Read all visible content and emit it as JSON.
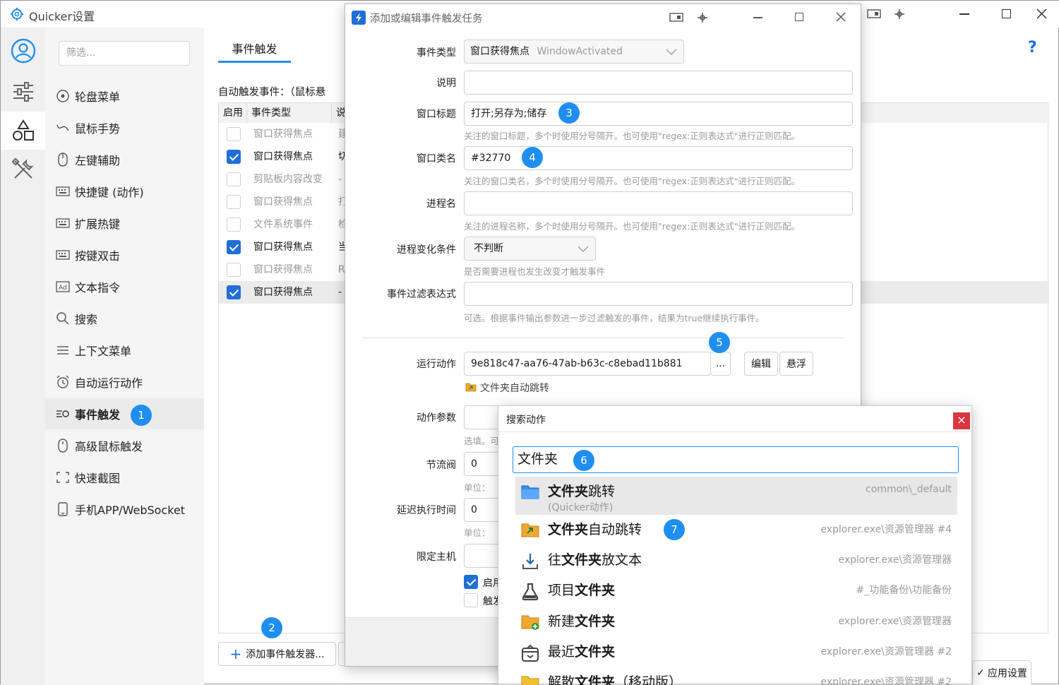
{
  "window": {
    "title": "Quicker设置",
    "help": "?"
  },
  "nav": {
    "filter_placeholder": "筛选...",
    "items": [
      {
        "label": "轮盘菜单"
      },
      {
        "label": "鼠标手势"
      },
      {
        "label": "左键辅助"
      },
      {
        "label": "快捷键 (动作)"
      },
      {
        "label": "扩展热键"
      },
      {
        "label": "按键双击"
      },
      {
        "label": "文本指令"
      },
      {
        "label": "搜索"
      },
      {
        "label": "上下文菜单"
      },
      {
        "label": "自动运行动作"
      },
      {
        "label": "事件触发"
      },
      {
        "label": "高级鼠标触发"
      },
      {
        "label": "快速截图"
      },
      {
        "label": "手机APP/WebSocket"
      }
    ]
  },
  "badges": [
    "1",
    "2",
    "3",
    "4",
    "5",
    "6",
    "7"
  ],
  "content": {
    "tab": "事件触发",
    "auto_label": "自动触发事件：（鼠标悬",
    "columns": [
      "启用",
      "事件类型",
      "说"
    ],
    "rows": [
      {
        "enabled": false,
        "type": "窗口获得焦点",
        "desc": "建",
        "dim": true
      },
      {
        "enabled": true,
        "type": "窗口获得焦点",
        "desc": "切",
        "dim": false
      },
      {
        "enabled": false,
        "type": "剪贴板内容改变",
        "desc": "-",
        "dim": true
      },
      {
        "enabled": false,
        "type": "窗口获得焦点",
        "desc": "打",
        "dim": true
      },
      {
        "enabled": false,
        "type": "文件系统事件",
        "desc": "检",
        "dim": true
      },
      {
        "enabled": true,
        "type": "窗口获得焦点",
        "desc": "当",
        "dim": false
      },
      {
        "enabled": false,
        "type": "窗口获得焦点",
        "desc": "R",
        "dim": true
      },
      {
        "enabled": true,
        "type": "窗口获得焦点",
        "desc": "-",
        "dim": false
      }
    ],
    "add_button": "添加事件触发器...",
    "apply_button": "应用设置"
  },
  "dialog": {
    "title": "添加或编辑事件触发任务",
    "event_type_label": "事件类型",
    "event_type_value": "窗口获得焦点",
    "event_type_en": "WindowActivated",
    "desc_label": "说明",
    "desc_value": "",
    "win_title_label": "窗口标题",
    "win_title_value": "打开;另存为;储存",
    "win_title_hint": "关注的窗口标题，多个时使用分号隔开。也可使用\"regex:正则表达式\"进行正则匹配。",
    "win_class_label": "窗口类名",
    "win_class_value": "#32770",
    "win_class_hint": "关注的窗口类名，多个时使用分号隔开。也可使用\"regex:正则表达式\"进行正则匹配。",
    "proc_label": "进程名",
    "proc_value": "",
    "proc_hint": "关注的进程名称，多个时使用分号隔开。也可使用\"regex:正则表达式\"进行正则匹配。",
    "proc_change_label": "进程变化条件",
    "proc_change_value": "不判断",
    "proc_change_hint": "是否需要进程也发生改变才触发事件",
    "filter_label": "事件过滤表达式",
    "filter_value": "",
    "filter_hint": "可选。根据事件输出参数进一步过滤触发的事件，结果为true继续执行事件。",
    "action_label": "运行动作",
    "action_value": "9e818c47-aa76-47ab-b63c-c8ebad11b881",
    "browse_button": "...",
    "edit_button": "编辑",
    "float_button": "悬浮",
    "action_name": "文件夹自动跳转",
    "param_label": "动作参数",
    "param_hint": "选填。可",
    "throttle_label": "节流阀",
    "throttle_value": "0",
    "throttle_hint": "单位：",
    "delay_label": "延迟执行时间",
    "delay_value": "0",
    "delay_hint": "单位：",
    "host_label": "限定主机",
    "enable_check": "启用",
    "trigger_check": "触发"
  },
  "search_popup": {
    "title": "搜索动作",
    "close": "×",
    "query": "文件夹",
    "results": [
      {
        "pre": "",
        "hl": "文件夹",
        "post": "跳转",
        "src": "common\\_default",
        "sub": "(Quicker动作)",
        "icon": "folder-blue-icon"
      },
      {
        "pre": "",
        "hl": "文件夹",
        "post": "自动跳转",
        "src": "explorer.exe\\资源管理器 #4",
        "sub": "",
        "icon": "folder-arrow-icon"
      },
      {
        "pre": "往",
        "hl": "文件夹",
        "post": "放文本",
        "src": "explorer.exe\\资源管理器",
        "sub": "",
        "icon": "download-icon"
      },
      {
        "pre": "项目",
        "hl": "文件夹",
        "post": "",
        "src": "#_功能备份\\功能备份",
        "sub": "",
        "icon": "flask-icon"
      },
      {
        "pre": "新建",
        "hl": "文件夹",
        "post": "",
        "src": "explorer.exe\\资源管理器",
        "sub": "",
        "icon": "folder-add-icon"
      },
      {
        "pre": "最近",
        "hl": "文件夹",
        "post": "",
        "src": "explorer.exe\\资源管理器 #2",
        "sub": "",
        "icon": "box-icon"
      },
      {
        "pre": "解散",
        "hl": "文件夹",
        "post": "（移动版）",
        "src": "explorer.exe\\资源管理器 #2",
        "sub": "",
        "icon": "folder-yellow-icon"
      }
    ]
  },
  "colors": {
    "accent": "#1f8ef1",
    "checkbox": "#1f6fd6",
    "selected_row": "#ebebeb"
  }
}
